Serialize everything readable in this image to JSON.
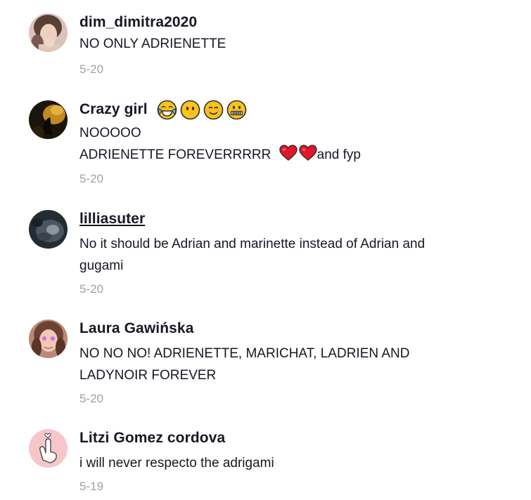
{
  "comments": [
    {
      "username": "dim_dimitra2020",
      "lines": [
        "NO ONLY ADRIENETTE"
      ],
      "date": "5-20"
    },
    {
      "username": "Crazy girl",
      "username_emojis": [
        "tears-of-joy-emoji",
        "no-mouth-face-emoji",
        "smiling-face-emoji",
        "zipper-mouth-face-emoji"
      ],
      "lines": [
        "NOOOOO",
        "ADRIENETTE FOREVERRRRR"
      ],
      "line2_suffix": "and fyp",
      "line2_emojis": [
        "red-heart-emoji",
        "red-heart-emoji"
      ],
      "date": "5-20"
    },
    {
      "username": "lilliasuter",
      "lines": [
        "No it should be Adrian and marinette instead of Adrian and",
        "gugami"
      ],
      "date": "5-20"
    },
    {
      "username": "Laura Gawińska",
      "lines": [
        "NO NO NO! ADRIENETTE, MARICHAT, LADRIEN AND",
        "LADYNOIR FOREVER"
      ],
      "date": "5-20"
    },
    {
      "username": "Litzi Gomez cordova",
      "lines": [
        "i will never respecto the adrigami"
      ],
      "date": "5-19"
    }
  ],
  "colors": {
    "text": "#161823",
    "date": "#a0a1a6",
    "heart": "#e0162b"
  }
}
